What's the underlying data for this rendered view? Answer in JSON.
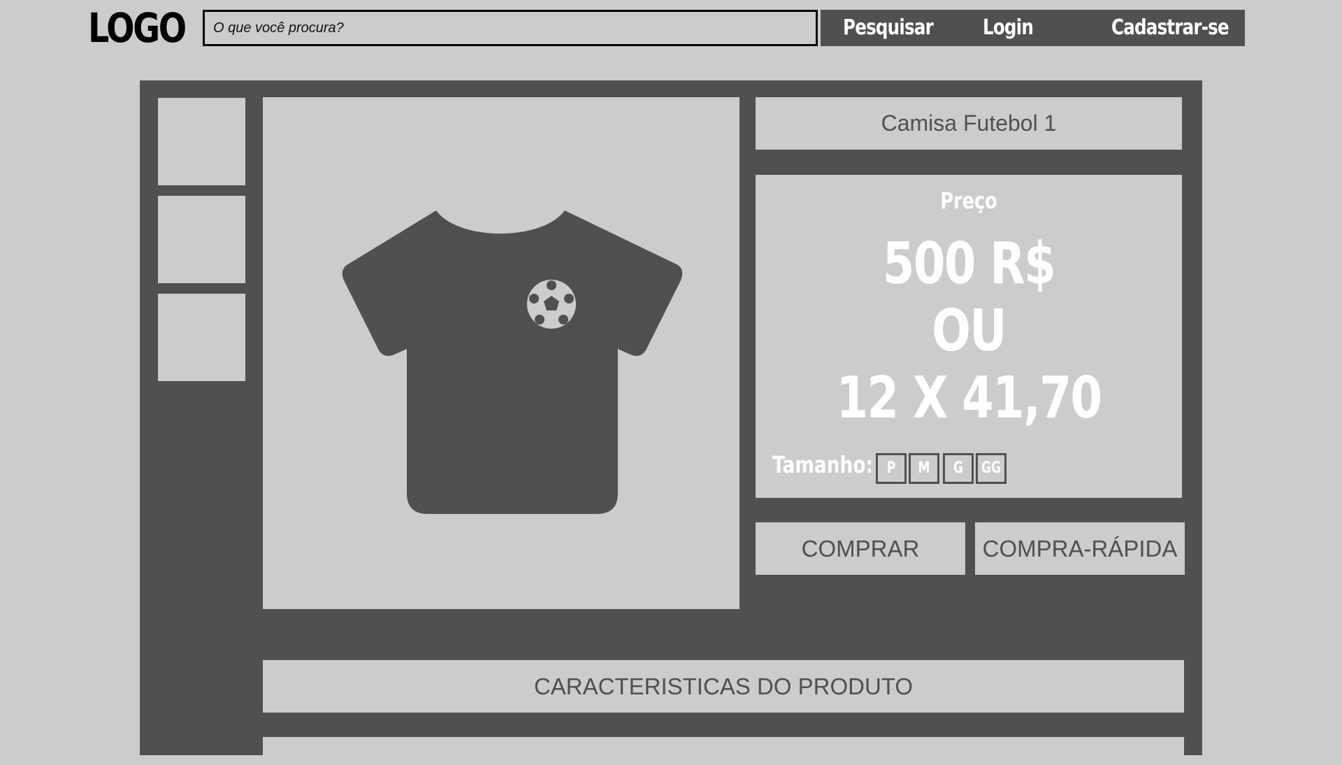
{
  "header": {
    "logo_text": "LOGO",
    "search_placeholder": "O que você procura?",
    "search_button": "Pesquisar",
    "login_button": "Login",
    "signup_button": "Cadastrar-se"
  },
  "product": {
    "title": "Camisa Futebol 1",
    "price_label": "Preço",
    "price": "500 R$",
    "or_text": "OU",
    "installments": "12 X 41,70",
    "size_label": "Tamanho:",
    "sizes": [
      "P",
      "M",
      "G",
      "GG"
    ],
    "image_icon": "tshirt-soccer-icon"
  },
  "actions": {
    "buy": "COMPRAR",
    "quick_buy": "COMPRA-RÁPIDA"
  },
  "sections": {
    "features": "CARACTERISTICAS DO PRODUTO"
  },
  "colors": {
    "panel": "#505050",
    "surface": "#cccccc",
    "text_light": "#ffffff"
  }
}
